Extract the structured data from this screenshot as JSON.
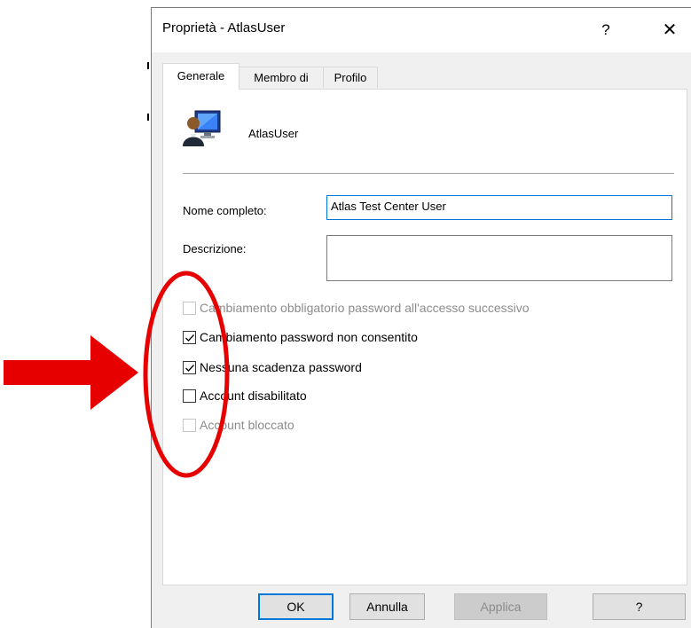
{
  "dialog": {
    "title": "Proprietà - AtlasUser",
    "help_glyph": "?",
    "close_glyph": "✕"
  },
  "tabs": [
    {
      "label": "Generale",
      "active": true
    },
    {
      "label": "Membro di",
      "active": false
    },
    {
      "label": "Profilo",
      "active": false
    }
  ],
  "user": {
    "name": "AtlasUser",
    "icon": "user-computer-icon"
  },
  "fields": {
    "full_name_label": "Nome completo:",
    "full_name_value": "Atlas Test Center User",
    "description_label": "Descrizione:",
    "description_value": ""
  },
  "checkboxes": [
    {
      "label": "Cambiamento obbligatorio password all'accesso successivo",
      "checked": false,
      "enabled": false
    },
    {
      "label": "Cambiamento password non consentito",
      "checked": true,
      "enabled": true
    },
    {
      "label": "Nessuna scadenza password",
      "checked": true,
      "enabled": true
    },
    {
      "label": "Account disabilitato",
      "checked": false,
      "enabled": true
    },
    {
      "label": "Account bloccato",
      "checked": false,
      "enabled": false
    }
  ],
  "buttons": {
    "ok": "OK",
    "cancel": "Annulla",
    "apply": "Applica",
    "help": "?"
  },
  "annotation": {
    "color": "#e60000"
  }
}
